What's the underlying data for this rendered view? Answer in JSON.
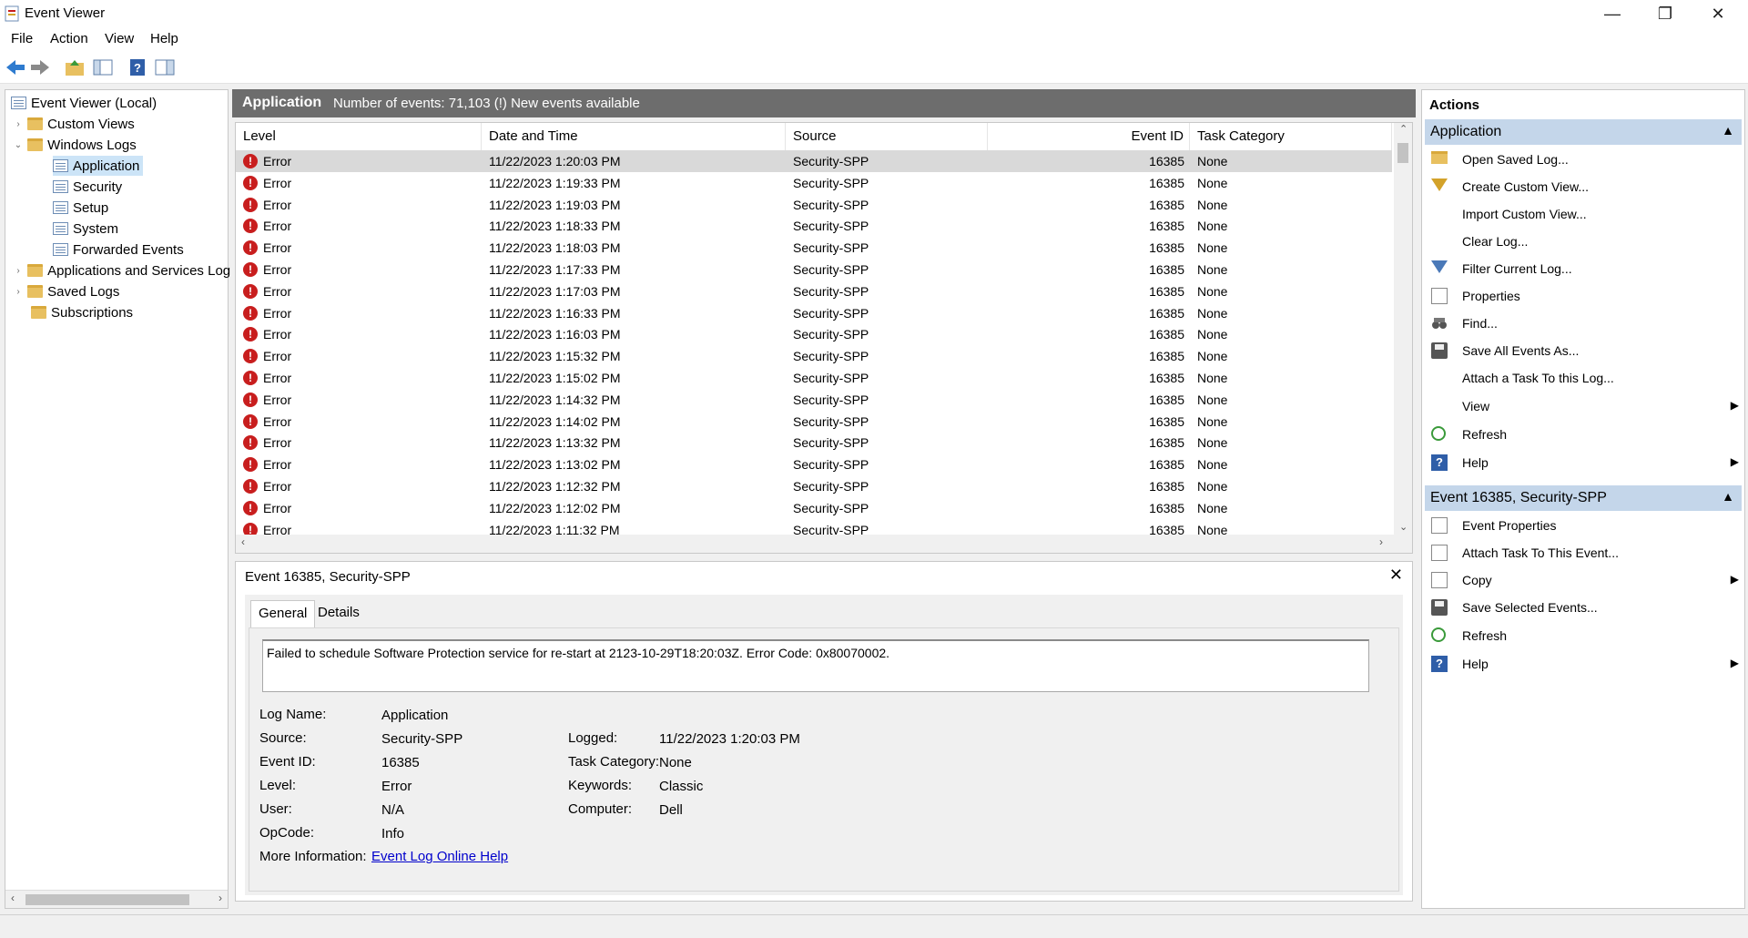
{
  "window": {
    "title": "Event Viewer",
    "minimize": "—",
    "restore": "❐",
    "close": "✕"
  },
  "menu": [
    "File",
    "Action",
    "View",
    "Help"
  ],
  "tree": {
    "root": "Event Viewer (Local)",
    "custom_views": "Custom Views",
    "windows_logs": "Windows Logs",
    "logs": [
      "Application",
      "Security",
      "Setup",
      "System",
      "Forwarded Events"
    ],
    "app_services": "Applications and Services Log",
    "saved_logs": "Saved Logs",
    "subscriptions": "Subscriptions"
  },
  "log_header": {
    "name": "Application",
    "info": "Number of events: 71,103 (!) New events available"
  },
  "columns": [
    "Level",
    "Date and Time",
    "Source",
    "Event ID",
    "Task Category"
  ],
  "events": [
    {
      "level": "Error",
      "datetime": "11/22/2023 1:20:03 PM",
      "source": "Security-SPP",
      "event_id": "16385",
      "category": "None"
    },
    {
      "level": "Error",
      "datetime": "11/22/2023 1:19:33 PM",
      "source": "Security-SPP",
      "event_id": "16385",
      "category": "None"
    },
    {
      "level": "Error",
      "datetime": "11/22/2023 1:19:03 PM",
      "source": "Security-SPP",
      "event_id": "16385",
      "category": "None"
    },
    {
      "level": "Error",
      "datetime": "11/22/2023 1:18:33 PM",
      "source": "Security-SPP",
      "event_id": "16385",
      "category": "None"
    },
    {
      "level": "Error",
      "datetime": "11/22/2023 1:18:03 PM",
      "source": "Security-SPP",
      "event_id": "16385",
      "category": "None"
    },
    {
      "level": "Error",
      "datetime": "11/22/2023 1:17:33 PM",
      "source": "Security-SPP",
      "event_id": "16385",
      "category": "None"
    },
    {
      "level": "Error",
      "datetime": "11/22/2023 1:17:03 PM",
      "source": "Security-SPP",
      "event_id": "16385",
      "category": "None"
    },
    {
      "level": "Error",
      "datetime": "11/22/2023 1:16:33 PM",
      "source": "Security-SPP",
      "event_id": "16385",
      "category": "None"
    },
    {
      "level": "Error",
      "datetime": "11/22/2023 1:16:03 PM",
      "source": "Security-SPP",
      "event_id": "16385",
      "category": "None"
    },
    {
      "level": "Error",
      "datetime": "11/22/2023 1:15:32 PM",
      "source": "Security-SPP",
      "event_id": "16385",
      "category": "None"
    },
    {
      "level": "Error",
      "datetime": "11/22/2023 1:15:02 PM",
      "source": "Security-SPP",
      "event_id": "16385",
      "category": "None"
    },
    {
      "level": "Error",
      "datetime": "11/22/2023 1:14:32 PM",
      "source": "Security-SPP",
      "event_id": "16385",
      "category": "None"
    },
    {
      "level": "Error",
      "datetime": "11/22/2023 1:14:02 PM",
      "source": "Security-SPP",
      "event_id": "16385",
      "category": "None"
    },
    {
      "level": "Error",
      "datetime": "11/22/2023 1:13:32 PM",
      "source": "Security-SPP",
      "event_id": "16385",
      "category": "None"
    },
    {
      "level": "Error",
      "datetime": "11/22/2023 1:13:02 PM",
      "source": "Security-SPP",
      "event_id": "16385",
      "category": "None"
    },
    {
      "level": "Error",
      "datetime": "11/22/2023 1:12:32 PM",
      "source": "Security-SPP",
      "event_id": "16385",
      "category": "None"
    },
    {
      "level": "Error",
      "datetime": "11/22/2023 1:12:02 PM",
      "source": "Security-SPP",
      "event_id": "16385",
      "category": "None"
    },
    {
      "level": "Error",
      "datetime": "11/22/2023 1:11:32 PM",
      "source": "Security-SPP",
      "event_id": "16385",
      "category": "None"
    }
  ],
  "detail": {
    "title": "Event 16385, Security-SPP",
    "tabs": [
      "General",
      "Details"
    ],
    "message": "Failed to schedule Software Protection service for re-start at 2123-10-29T18:20:03Z. Error Code: 0x80070002.",
    "labels": {
      "log_name": "Log Name:",
      "source": "Source:",
      "event_id": "Event ID:",
      "level": "Level:",
      "user": "User:",
      "opcode": "OpCode:",
      "more_info": "More Information:",
      "logged": "Logged:",
      "task_category": "Task Category:",
      "keywords": "Keywords:",
      "computer": "Computer:"
    },
    "values": {
      "log_name": "Application",
      "source": "Security-SPP",
      "event_id": "16385",
      "level": "Error",
      "user": "N/A",
      "opcode": "Info",
      "more_info_link": "Event Log Online Help",
      "logged": "11/22/2023 1:20:03 PM",
      "task_category": "None",
      "keywords": "Classic",
      "computer": "Dell"
    }
  },
  "actions": {
    "title": "Actions",
    "section1": "Application",
    "items1": [
      "Open Saved Log...",
      "Create Custom View...",
      "Import Custom View...",
      "Clear Log...",
      "Filter Current Log...",
      "Properties",
      "Find...",
      "Save All Events As...",
      "Attach a Task To this Log...",
      "View",
      "Refresh",
      "Help"
    ],
    "section2": "Event 16385, Security-SPP",
    "items2": [
      "Event Properties",
      "Attach Task To This Event...",
      "Copy",
      "Save Selected Events...",
      "Refresh",
      "Help"
    ]
  },
  "colors": {
    "header_bg": "#6d6d6d",
    "section_bg": "#c4d6ea",
    "error_red": "#c81e1e",
    "link_blue": "#0000cc"
  }
}
